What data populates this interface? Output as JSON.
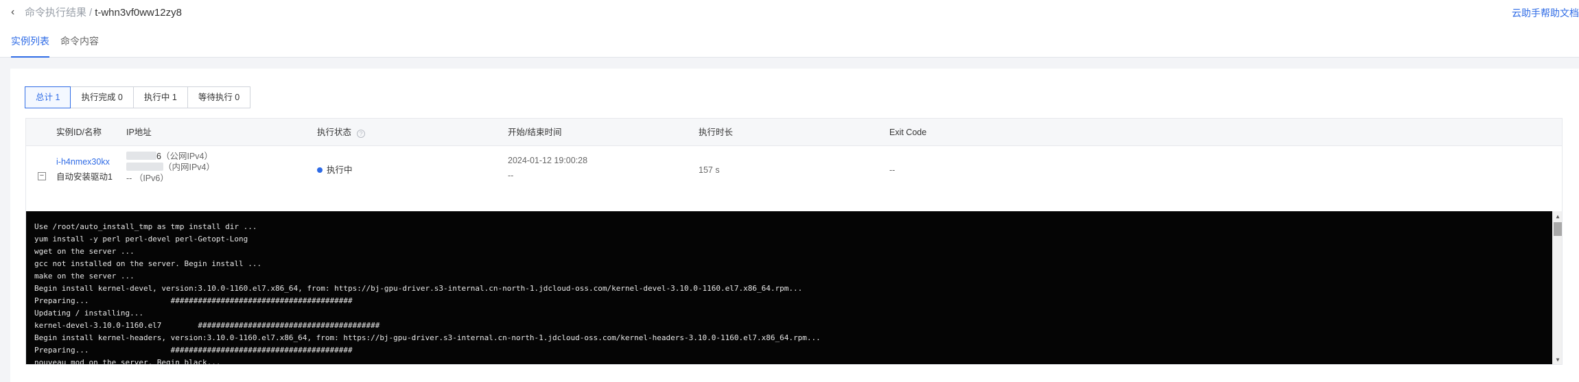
{
  "header": {
    "back_icon": "chevron-left-icon",
    "breadcrumb_parent": "命令执行结果",
    "breadcrumb_sep": "/",
    "breadcrumb_current": "t-whn3vf0ww12zy8",
    "help_link": "云助手帮助文档"
  },
  "tabs": [
    {
      "label": "实例列表",
      "active": true
    },
    {
      "label": "命令内容",
      "active": false
    }
  ],
  "filters": [
    {
      "label": "总计 1",
      "active": true
    },
    {
      "label": "执行完成 0",
      "active": false
    },
    {
      "label": "执行中 1",
      "active": false
    },
    {
      "label": "等待执行 0",
      "active": false
    }
  ],
  "table": {
    "columns": [
      "实例ID/名称",
      "IP地址",
      "执行状态",
      "开始/结束时间",
      "执行时长",
      "Exit Code"
    ],
    "status_info_icon": "info-icon",
    "rows": [
      {
        "expand_icon": "minus-square-icon",
        "instance_id": "i-h4nmex30kx",
        "instance_name": "自动安装驱动1",
        "ip_public_suffix": "6",
        "ip_public_label": "（公网IPv4）",
        "ip_private_label": "（内网IPv4）",
        "ip_v6_value": "--",
        "ip_v6_label": "（IPv6）",
        "status": "执行中",
        "status_color": "#2e6be6",
        "start_time": "2024-01-12 19:00:28",
        "end_time": "--",
        "duration": "157 s",
        "exit_code": "--"
      }
    ]
  },
  "console": {
    "lines": [
      "Use /root/auto_install_tmp as tmp install dir ...",
      "yum install -y perl perl-devel perl-Getopt-Long",
      "wget on the server ...",
      "gcc not installed on the server. Begin install ...",
      "make on the server ...",
      "Begin install kernel-devel, version:3.10.0-1160.el7.x86_64, from: https://bj-gpu-driver.s3-internal.cn-north-1.jdcloud-oss.com/kernel-devel-3.10.0-1160.el7.x86_64.rpm...",
      "Preparing...                  ########################################",
      "Updating / installing...",
      "kernel-devel-3.10.0-1160.el7        ########################################",
      "Begin install kernel-headers, version:3.10.0-1160.el7.x86_64, from: https://bj-gpu-driver.s3-internal.cn-north-1.jdcloud-oss.com/kernel-headers-3.10.0-1160.el7.x86_64.rpm...",
      "Preparing...                  ########################################",
      "nouveau mod on the server. Begin black..."
    ]
  },
  "colors": {
    "accent": "#2e6be6",
    "console_bg": "#050505"
  }
}
